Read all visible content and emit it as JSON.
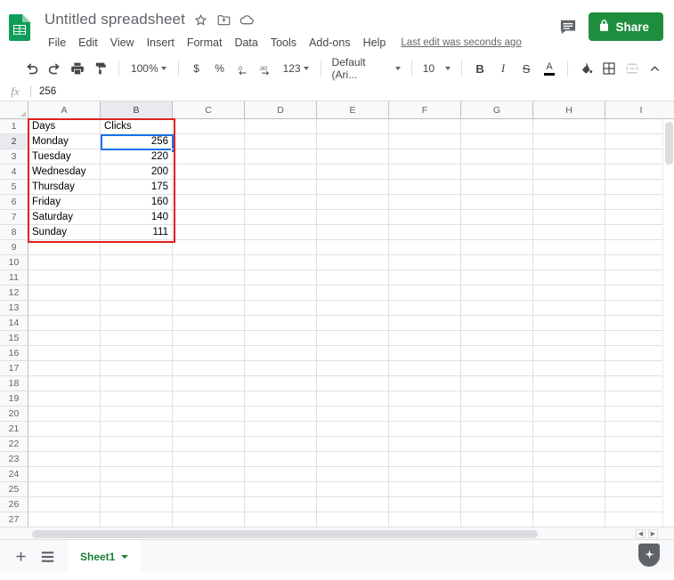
{
  "app": {
    "logo_icon": "sheets-logo-icon",
    "doc_title": "Untitled spreadsheet",
    "star_icon": "star-icon",
    "move_icon": "move-to-folder-icon",
    "cloud_icon": "cloud-saved-icon",
    "last_edit": "Last edit was seconds ago",
    "comment_icon": "comment-icon",
    "share_label": "Share",
    "share_lock_icon": "lock-icon",
    "share_color": "#1e8e3e"
  },
  "menus": [
    {
      "label": "File"
    },
    {
      "label": "Edit"
    },
    {
      "label": "View"
    },
    {
      "label": "Insert"
    },
    {
      "label": "Format"
    },
    {
      "label": "Data"
    },
    {
      "label": "Tools"
    },
    {
      "label": "Add-ons"
    },
    {
      "label": "Help"
    }
  ],
  "toolbar": {
    "undo_icon": "undo-icon",
    "redo_icon": "redo-icon",
    "print_icon": "print-icon",
    "paint_icon": "paint-format-icon",
    "zoom_value": "100%",
    "currency_label": "$",
    "percent_label": "%",
    "decimal_decrease_label": ".0",
    "decimal_increase_label": ".00",
    "number_format_label": "123",
    "font_name": "Default (Ari...",
    "font_size": "10",
    "bold_label": "B",
    "italic_label": "I",
    "strikethrough_label": "S",
    "text_color_label": "A",
    "fill_color_icon": "fill-color-icon",
    "borders_icon": "borders-icon",
    "merge_icon": "merge-cells-icon",
    "collapse_icon": "chevron-up-icon"
  },
  "formula_bar": {
    "fx_label": "fx",
    "value": "256"
  },
  "grid": {
    "columns": [
      "A",
      "B",
      "C",
      "D",
      "E",
      "F",
      "G",
      "H",
      "I"
    ],
    "active_column": "B",
    "active_row": 2,
    "rows": [
      1,
      2,
      3,
      4,
      5,
      6,
      7,
      8,
      9,
      10,
      11,
      12,
      13,
      14,
      15,
      16,
      17,
      18,
      19,
      20,
      21,
      22,
      23,
      24,
      25,
      26,
      27
    ],
    "selected_cell": "B2",
    "selection_color": "#1a73e8",
    "annotation_color": "#e02020",
    "data": [
      {
        "row": 1,
        "A": "Days",
        "B": "Clicks"
      },
      {
        "row": 2,
        "A": "Monday",
        "B": "256"
      },
      {
        "row": 3,
        "A": "Tuesday",
        "B": "220"
      },
      {
        "row": 4,
        "A": "Wednesday",
        "B": "200"
      },
      {
        "row": 5,
        "A": "Thursday",
        "B": "175"
      },
      {
        "row": 6,
        "A": "Friday",
        "B": "160"
      },
      {
        "row": 7,
        "A": "Saturday",
        "B": "140"
      },
      {
        "row": 8,
        "A": "Sunday",
        "B": "111"
      }
    ]
  },
  "sheet_bar": {
    "add_sheet_icon": "add-sheet-icon",
    "all_sheets_icon": "all-sheets-icon",
    "tab_name": "Sheet1",
    "tab_caret_icon": "chevron-down-icon",
    "explore_icon": "explore-icon"
  }
}
